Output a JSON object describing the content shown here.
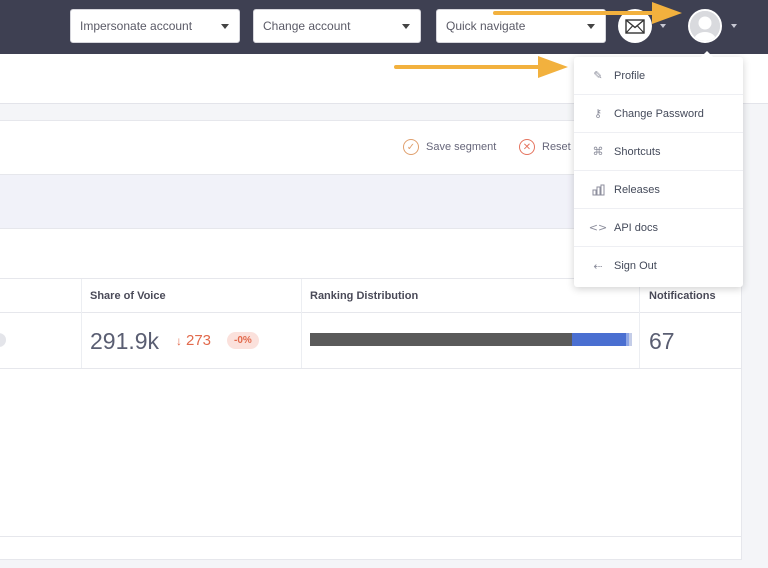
{
  "topbar": {
    "impersonate_label": "Impersonate account",
    "change_account_label": "Change account",
    "quick_navigate_label": "Quick navigate",
    "mail_icon": "mail-icon",
    "avatar_icon": "user-avatar-icon"
  },
  "toolbar": {
    "save_segment_label": "Save segment",
    "reset_label": "Reset"
  },
  "table": {
    "headers": {
      "share_of_voice": "Share of Voice",
      "ranking_distribution": "Ranking Distribution",
      "notifications": "Notifications"
    },
    "row": {
      "share_of_voice_value": "291.9k",
      "delta_value": "273",
      "delta_arrow": "↓",
      "delta_percent": "-0%",
      "notifications_value": "67",
      "ranking_distribution": [
        {
          "fraction": 0.815,
          "color": "#5a5a5a"
        },
        {
          "fraction": 0.165,
          "color": "#4a6fd1"
        },
        {
          "fraction": 0.01,
          "color": "#8ea6e6"
        },
        {
          "fraction": 0.01,
          "color": "#c4cde8"
        }
      ]
    }
  },
  "user_menu": {
    "items": [
      {
        "label": "Profile",
        "icon": "pencil-icon"
      },
      {
        "label": "Change Password",
        "icon": "key-icon"
      },
      {
        "label": "Shortcuts",
        "icon": "command-icon"
      },
      {
        "label": "Releases",
        "icon": "releases-icon"
      },
      {
        "label": "API docs",
        "icon": "code-icon"
      },
      {
        "label": "Sign Out",
        "icon": "sign-out-icon"
      }
    ]
  },
  "colors": {
    "topbar": "#3e4052",
    "annotation_arrow": "#f2b13e",
    "delta_negative": "#e26a4c"
  }
}
